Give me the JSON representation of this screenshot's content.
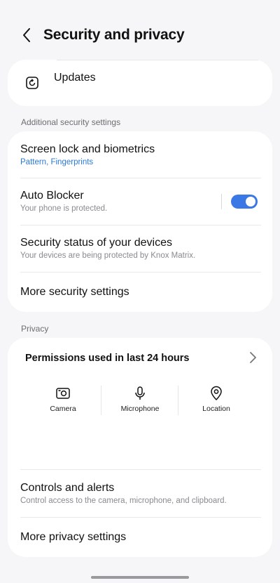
{
  "header": {
    "title": "Security and privacy"
  },
  "updates": {
    "label": "Updates"
  },
  "sections": {
    "additional_security": "Additional security settings",
    "privacy": "Privacy"
  },
  "security_items": {
    "screen_lock": {
      "title": "Screen lock and biometrics",
      "subtitle": "Pattern, Fingerprints"
    },
    "auto_blocker": {
      "title": "Auto Blocker",
      "subtitle": "Your phone is protected.",
      "enabled": true
    },
    "device_status": {
      "title": "Security status of your devices",
      "subtitle": "Your devices are being protected by Knox Matrix."
    },
    "more_security": {
      "title": "More security settings"
    }
  },
  "privacy": {
    "permissions_title": "Permissions used in last 24 hours",
    "permissions": [
      {
        "label": "Camera",
        "icon": "camera-icon"
      },
      {
        "label": "Microphone",
        "icon": "microphone-icon"
      },
      {
        "label": "Location",
        "icon": "location-icon"
      }
    ],
    "controls": {
      "title": "Controls and alerts",
      "subtitle": "Control access to the camera, microphone, and clipboard."
    },
    "more_privacy": {
      "title": "More privacy settings"
    }
  },
  "colors": {
    "accent": "#3a78e6",
    "link_blue": "#2a78d8",
    "background": "#f6f6f8"
  }
}
